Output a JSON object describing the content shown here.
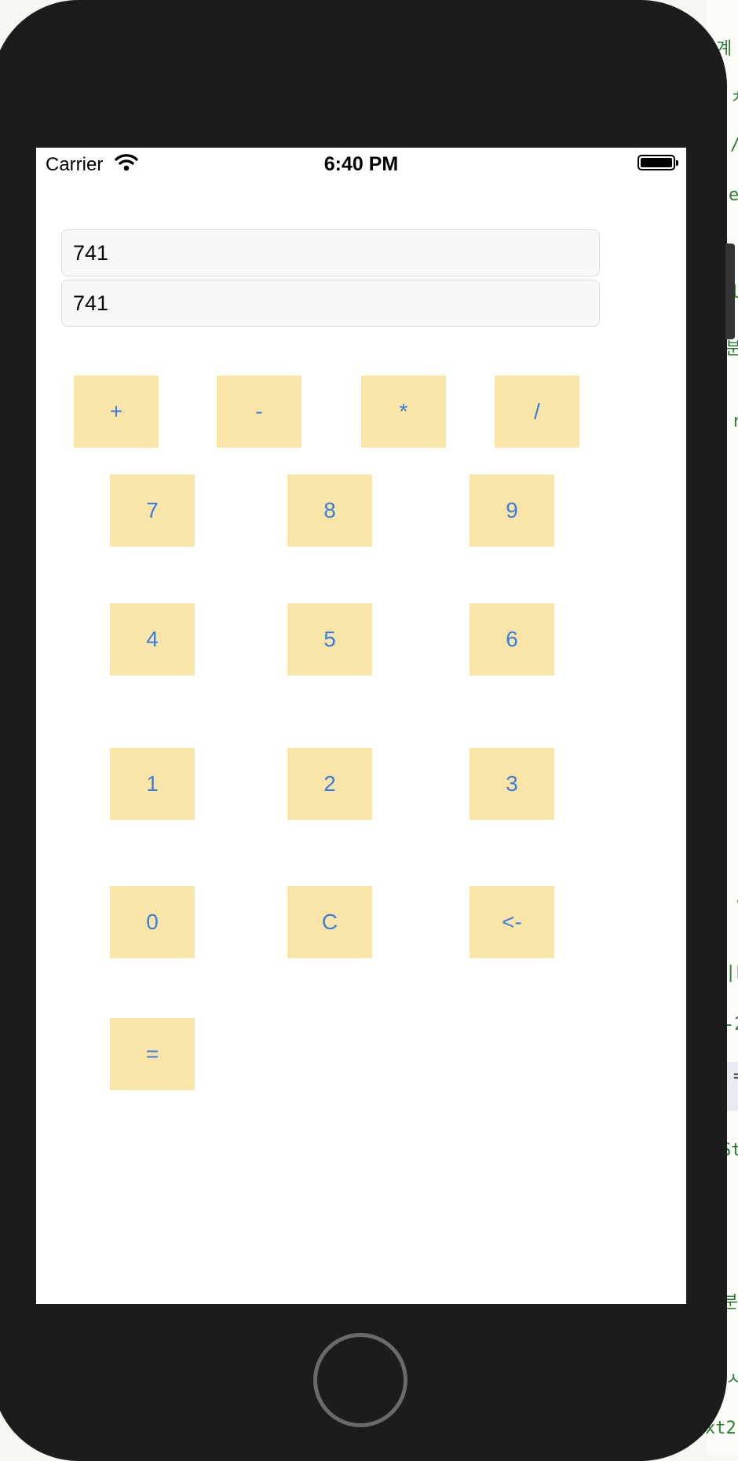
{
  "background_code": {
    "fragments": [
      "계",
      "ㅊ",
      "/",
      "e",
      "l",
      "분",
      "r",
      "·",
      "|L",
      "-2",
      "=",
      "St",
      "분",
      "ㅅ",
      "xt2"
    ]
  },
  "status_bar": {
    "carrier": "Carrier",
    "time": "6:40 PM"
  },
  "fields": {
    "first_value": "741",
    "second_value": "741"
  },
  "keypad": {
    "operators": [
      "+",
      "-",
      "*",
      "/"
    ],
    "rows": [
      [
        "7",
        "8",
        "9"
      ],
      [
        "4",
        "5",
        "6"
      ],
      [
        "1",
        "2",
        "3"
      ],
      [
        "0",
        "C",
        "<-"
      ],
      [
        "="
      ]
    ]
  },
  "colors": {
    "key_background": "#fae5a8",
    "key_text": "#3a7de0",
    "device_body": "#1c1c1c"
  },
  "icons": [
    "wifi-icon",
    "battery-icon",
    "home-button-icon"
  ]
}
